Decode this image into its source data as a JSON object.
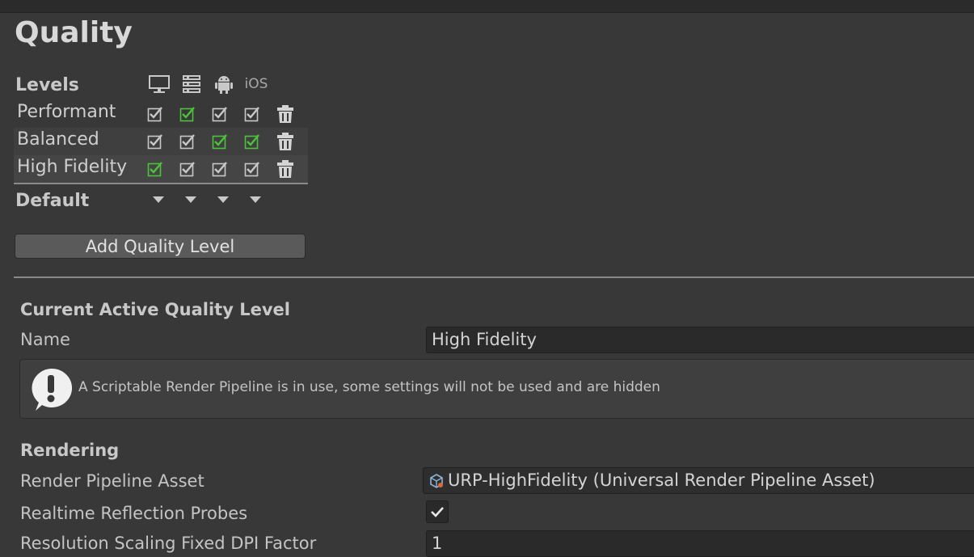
{
  "title": "Quality",
  "levels": {
    "header": "Levels",
    "platforms": [
      {
        "icon": "monitor-icon"
      },
      {
        "icon": "server-icon"
      },
      {
        "icon": "android-icon"
      },
      {
        "icon": "ios-icon",
        "label": "iOS"
      }
    ],
    "rows": [
      {
        "name": "Performant",
        "checks": [
          "checked",
          "default",
          "checked",
          "checked"
        ]
      },
      {
        "name": "Balanced",
        "checks": [
          "checked",
          "checked",
          "default",
          "default"
        ]
      },
      {
        "name": "High Fidelity",
        "checks": [
          "default",
          "checked",
          "checked",
          "checked"
        ]
      }
    ],
    "default_label": "Default",
    "add_button": "Add Quality Level"
  },
  "current": {
    "header": "Current Active Quality Level",
    "name_label": "Name",
    "name_value": "High Fidelity",
    "help_text": "A Scriptable Render Pipeline is in use, some settings will not be used and are hidden"
  },
  "rendering": {
    "header": "Rendering",
    "pipeline_label": "Render Pipeline Asset",
    "pipeline_value": "URP-HighFidelity (Universal Render Pipeline Asset)",
    "reflection_label": "Realtime Reflection Probes",
    "reflection_checked": true,
    "dpi_label": "Resolution Scaling Fixed DPI Factor",
    "dpi_value": "1"
  },
  "colors": {
    "background": "#383838",
    "default_check": "#4cc23a",
    "check": "#c8c8c8"
  }
}
